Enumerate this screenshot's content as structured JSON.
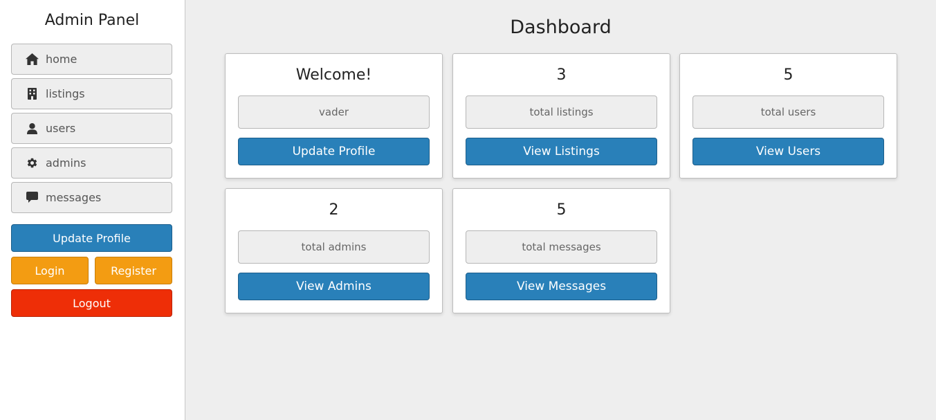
{
  "sidebar": {
    "title": "Admin Panel",
    "nav": [
      {
        "label": "home",
        "icon": "home-icon"
      },
      {
        "label": "listings",
        "icon": "building-icon"
      },
      {
        "label": "users",
        "icon": "user-icon"
      },
      {
        "label": "admins",
        "icon": "gear-icon"
      },
      {
        "label": "messages",
        "icon": "comment-icon"
      }
    ],
    "update_profile_label": "Update Profile",
    "login_label": "Login",
    "register_label": "Register",
    "logout_label": "Logout"
  },
  "main": {
    "title": "Dashboard",
    "cards": [
      {
        "heading": "Welcome!",
        "box": "vader",
        "button": "Update Profile"
      },
      {
        "heading": "3",
        "box": "total listings",
        "button": "View Listings"
      },
      {
        "heading": "5",
        "box": "total users",
        "button": "View Users"
      },
      {
        "heading": "2",
        "box": "total admins",
        "button": "View Admins"
      },
      {
        "heading": "5",
        "box": "total messages",
        "button": "View Messages"
      }
    ]
  },
  "colors": {
    "primary": "#2980b9",
    "warning": "#f39c12",
    "danger": "#ee2e07",
    "background": "#eeeeee"
  }
}
